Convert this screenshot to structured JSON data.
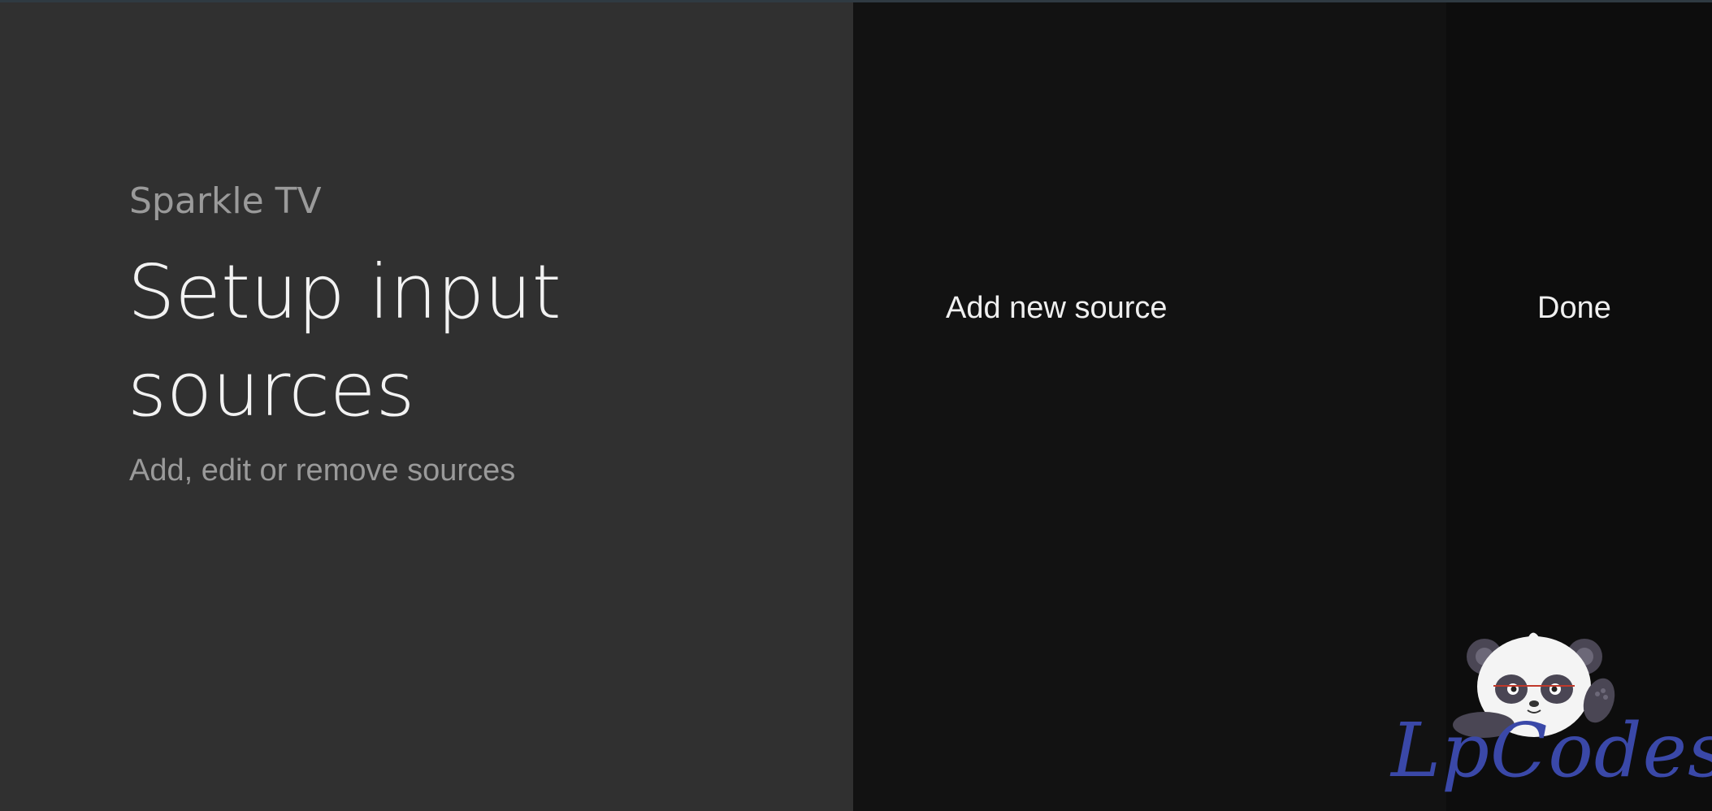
{
  "header": {
    "app_name": "Sparkle TV",
    "title": "Setup input sources",
    "subtitle": "Add, edit or remove sources"
  },
  "actions": {
    "add_label": "Add new source",
    "done_label": "Done"
  },
  "watermark": {
    "text": "LpCodes",
    "icon": "panda-logo-icon"
  },
  "colors": {
    "left_panel": "#303030",
    "middle_panel": "#121212",
    "right_panel": "#0d0d0d",
    "primary_text": "#f2f2f2",
    "secondary_text": "#9a9a9a",
    "watermark": "#3a48a8"
  }
}
